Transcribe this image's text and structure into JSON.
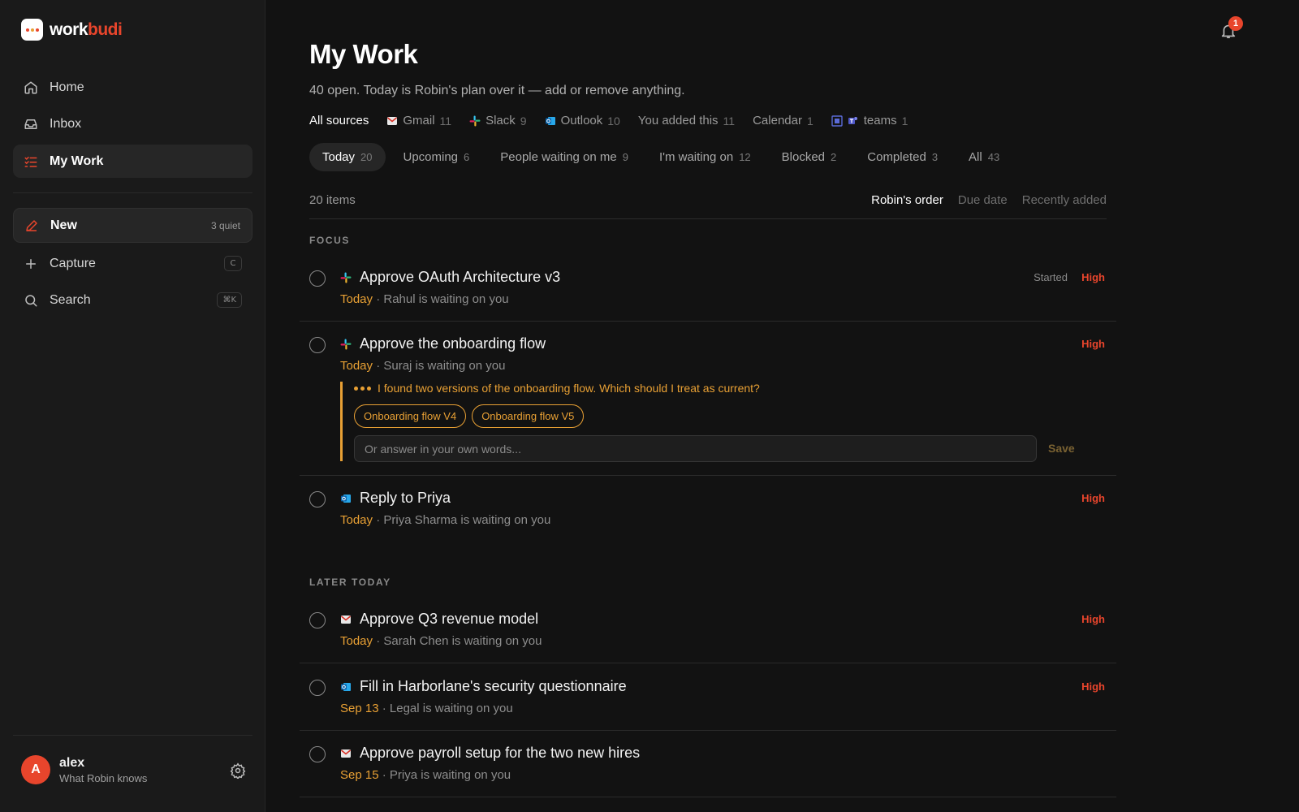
{
  "app": {
    "logo_prefix": "work",
    "logo_suffix": "budi"
  },
  "sidebar": {
    "nav": [
      {
        "label": "Home"
      },
      {
        "label": "Inbox"
      },
      {
        "label": "My Work"
      }
    ],
    "new": {
      "label": "New",
      "note": "3 quiet"
    },
    "capture": {
      "label": "Capture",
      "shortcut": "C"
    },
    "search": {
      "label": "Search",
      "shortcut": "⌘K"
    },
    "user": {
      "initial": "A",
      "name": "alex",
      "sub": "What Robin knows"
    }
  },
  "notifications": {
    "count": "1"
  },
  "main": {
    "title": "My Work",
    "subtitle": "40 open. Today is Robin's plan over it — add or remove anything.",
    "sources": [
      {
        "label": "All sources",
        "count": ""
      },
      {
        "label": "Gmail",
        "count": "11"
      },
      {
        "label": "Slack",
        "count": "9"
      },
      {
        "label": "Outlook",
        "count": "10"
      },
      {
        "label": "You added this",
        "count": "11"
      },
      {
        "label": "Calendar",
        "count": "1"
      },
      {
        "label": "teams",
        "count": "1"
      }
    ],
    "tabs": [
      {
        "label": "Today",
        "count": "20"
      },
      {
        "label": "Upcoming",
        "count": "6"
      },
      {
        "label": "People waiting on me",
        "count": "9"
      },
      {
        "label": "I'm waiting on",
        "count": "12"
      },
      {
        "label": "Blocked",
        "count": "2"
      },
      {
        "label": "Completed",
        "count": "3"
      },
      {
        "label": "All",
        "count": "43"
      }
    ],
    "items_count": "20 items",
    "sorts": [
      "Robin's order",
      "Due date",
      "Recently added"
    ],
    "sections": [
      {
        "label": "FOCUS"
      },
      {
        "label": "LATER TODAY"
      }
    ],
    "tasks": [
      {
        "title": "Approve OAuth Architecture v3",
        "source": "slack",
        "due": "Today",
        "waiting": "Rahul is waiting on you",
        "status": "Started",
        "priority": "High"
      },
      {
        "title": "Approve the onboarding flow",
        "source": "slack",
        "due": "Today",
        "waiting": "Suraj is waiting on you",
        "priority": "High",
        "question": {
          "text": "I found two versions of the onboarding flow. Which should I treat as current?",
          "options": [
            "Onboarding flow V4",
            "Onboarding flow V5"
          ],
          "placeholder": "Or answer in your own words...",
          "save": "Save"
        }
      },
      {
        "title": "Reply to Priya",
        "source": "outlook",
        "due": "Today",
        "waiting": "Priya Sharma is waiting on you",
        "priority": "High"
      },
      {
        "title": "Approve Q3 revenue model",
        "source": "gmail",
        "due": "Today",
        "waiting": "Sarah Chen is waiting on you",
        "priority": "High"
      },
      {
        "title": "Fill in Harborlane's security questionnaire",
        "source": "outlook",
        "due": "Sep 13",
        "waiting": "Legal is waiting on you",
        "priority": "High"
      },
      {
        "title": "Approve payroll setup for the two new hires",
        "source": "gmail",
        "due": "Sep 15",
        "waiting": "Priya is waiting on you",
        "priority": ""
      }
    ],
    "separator": " · "
  },
  "colors": {
    "accent": "#e8452c",
    "due": "#e8a034",
    "background": "#121212",
    "sidebar": "#1a1a1a"
  }
}
